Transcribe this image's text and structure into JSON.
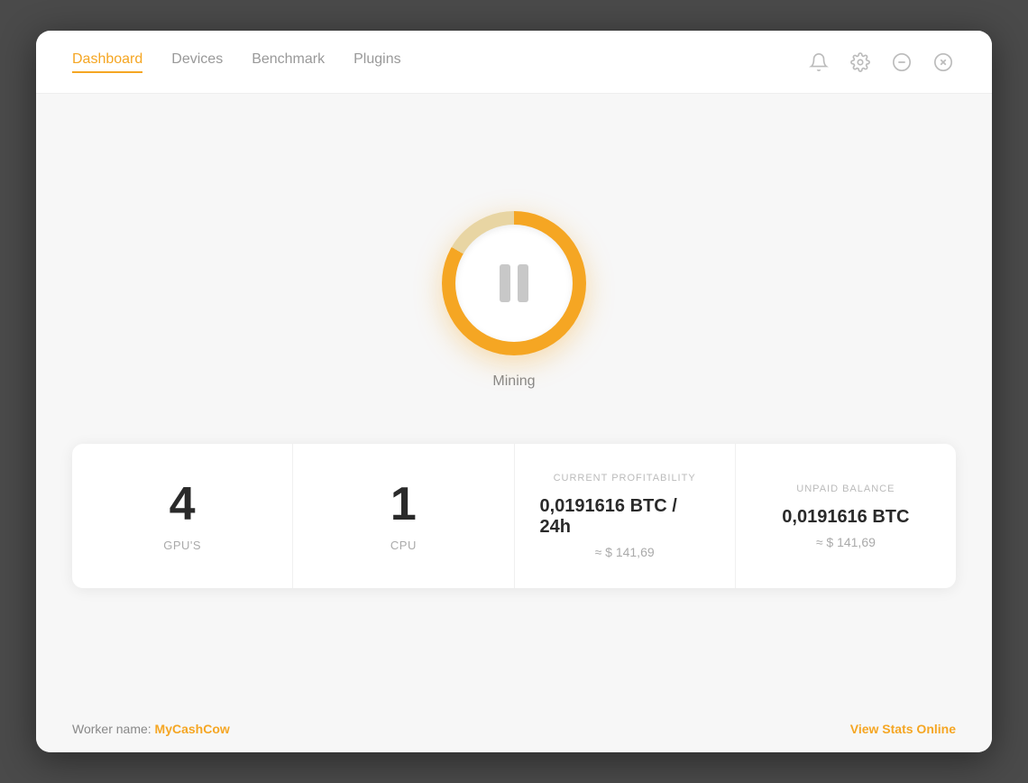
{
  "header": {
    "tabs": [
      {
        "id": "dashboard",
        "label": "Dashboard",
        "active": true
      },
      {
        "id": "devices",
        "label": "Devices",
        "active": false
      },
      {
        "id": "benchmark",
        "label": "Benchmark",
        "active": false
      },
      {
        "id": "plugins",
        "label": "Plugins",
        "active": false
      }
    ],
    "icons": [
      {
        "id": "bell",
        "symbol": "bell"
      },
      {
        "id": "settings",
        "symbol": "gear"
      },
      {
        "id": "minimize",
        "symbol": "minus"
      },
      {
        "id": "close",
        "symbol": "x-circle"
      }
    ]
  },
  "mining": {
    "status_label": "Mining",
    "button_state": "paused"
  },
  "stats": {
    "gpu_count": "4",
    "gpu_label": "GPU'S",
    "cpu_count": "1",
    "cpu_label": "CPU",
    "profitability": {
      "section_label": "CURRENT PROFITABILITY",
      "value": "0,0191616 BTC / 24h",
      "usd_approx": "≈ $ 141,69"
    },
    "balance": {
      "section_label": "UNPAID BALANCE",
      "value": "0,0191616 BTC",
      "usd_approx": "≈ $ 141,69"
    }
  },
  "footer": {
    "worker_prefix": "Worker name: ",
    "worker_name": "MyCashCow",
    "view_stats_label": "View Stats Online"
  }
}
